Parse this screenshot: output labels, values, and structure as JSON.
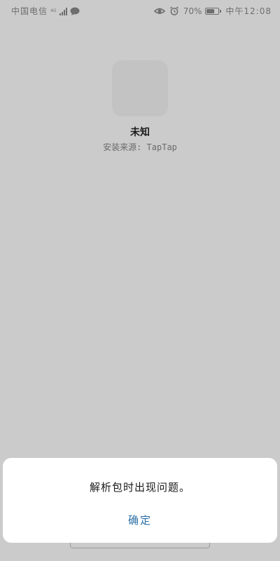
{
  "status_bar": {
    "carrier": "中国电信",
    "network_type": "4G",
    "battery": "70%",
    "battery_level": 0.7,
    "time": "中午12:08",
    "icons": [
      "signal-icon",
      "chat-icon",
      "eye-icon",
      "alarm-icon",
      "battery-icon"
    ]
  },
  "app": {
    "name": "未知",
    "install_source": "安装来源: TapTap"
  },
  "dialog": {
    "message": "解析包时出现问题。",
    "ok_label": "确定"
  },
  "colors": {
    "background": "#cbcbcb",
    "dialog_background": "#ffffff",
    "accent": "#2a6fa6"
  }
}
